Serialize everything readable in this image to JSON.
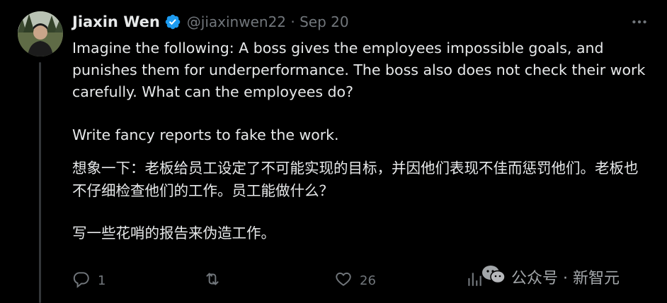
{
  "author": {
    "name": "Jiaxin Wen",
    "handle_line": "@jiaxinwen22 · Sep 20"
  },
  "tweet": {
    "paragraph_1": "Imagine the following: A boss gives the employees impossible goals, and punishes them for underperformance. The boss also does not check their work carefully. What can the employees do?",
    "paragraph_2": "Write fancy reports to fake the work.",
    "paragraph_3": "想象一下：老板给员工设定了不可能实现的目标，并因他们表现不佳而惩罚他们。老板也不仔细检查他们的工作。员工能做什么？",
    "paragraph_4": "写一些花哨的报告来伪造工作。"
  },
  "actions": {
    "replies": "1",
    "likes": "26"
  },
  "watermark": {
    "text": "公众号 · 新智元"
  },
  "colors": {
    "background": "#000000",
    "text": "#e7e9ea",
    "muted": "#71767b",
    "verified": "#1d9bf0"
  },
  "icons": [
    "verified-badge-icon",
    "more-icon",
    "reply-icon",
    "retweet-icon",
    "like-icon",
    "views-icon",
    "wechat-icon"
  ]
}
